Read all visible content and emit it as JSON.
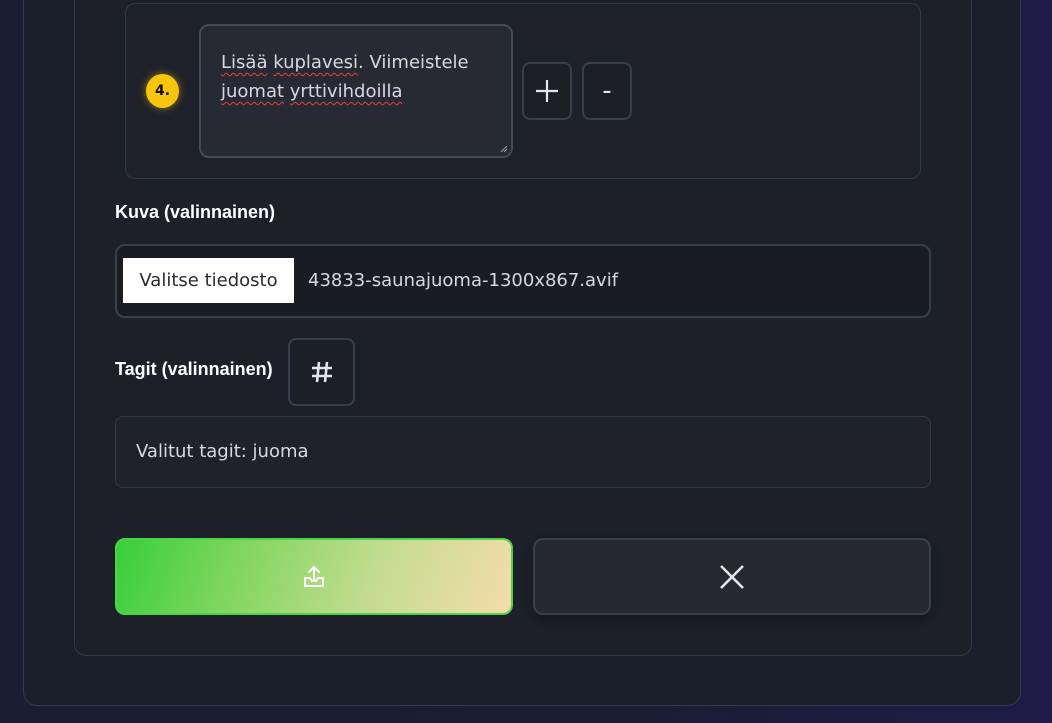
{
  "step": {
    "number": "4.",
    "text_parts": [
      "Lisää",
      " ",
      "kuplavesi",
      ". ",
      "Viimeistele",
      " ",
      "juomat",
      " ",
      "yrttivihdoilla"
    ],
    "add_label": "+",
    "remove_label": "-"
  },
  "image_section": {
    "label": "Kuva (valinnainen)",
    "choose_file_label": "Valitse tiedosto",
    "file_name": "43833-saunajuoma-1300x867.avif"
  },
  "tags_section": {
    "label": "Tagit (valinnainen)",
    "selected_tags_text": "Valitut tagit: juoma"
  },
  "actions": {
    "upload_icon": "upload-icon",
    "cancel_icon": "close-icon"
  },
  "colors": {
    "step_badge": "#f7c40e",
    "upload_gradient_start": "#37cf3a",
    "upload_gradient_end": "#f4dcaa",
    "card_background": "#1e2029"
  }
}
